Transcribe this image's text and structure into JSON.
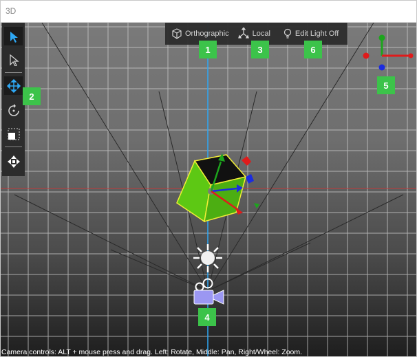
{
  "window": {
    "title": "3D"
  },
  "top_toolbar": {
    "projection_label": "Orthographic",
    "space_label": "Local",
    "light_label": "Edit Light Off"
  },
  "tools": [
    {
      "name": "select-arrow",
      "active": true
    },
    {
      "name": "select-outline",
      "active": false
    },
    {
      "name": "move",
      "active": true
    },
    {
      "name": "rotate",
      "active": false
    },
    {
      "name": "scale",
      "active": false
    },
    {
      "name": "transform",
      "active": false
    }
  ],
  "callouts": [
    "1",
    "2",
    "3",
    "4",
    "5",
    "6"
  ],
  "colors": {
    "accent_blue": "#2ea8f5",
    "callout_green": "#3cc34a",
    "axis_red": "#e01b1b",
    "axis_green": "#1da51d",
    "axis_blue": "#1b2ce0",
    "cube_green": "#5dc814",
    "camera_purple": "#9b97f2"
  },
  "status": {
    "text": "Camera controls: ALT + mouse press and drag. Left: Rotate, Middle: Pan, Right/Wheel: Zoom."
  }
}
